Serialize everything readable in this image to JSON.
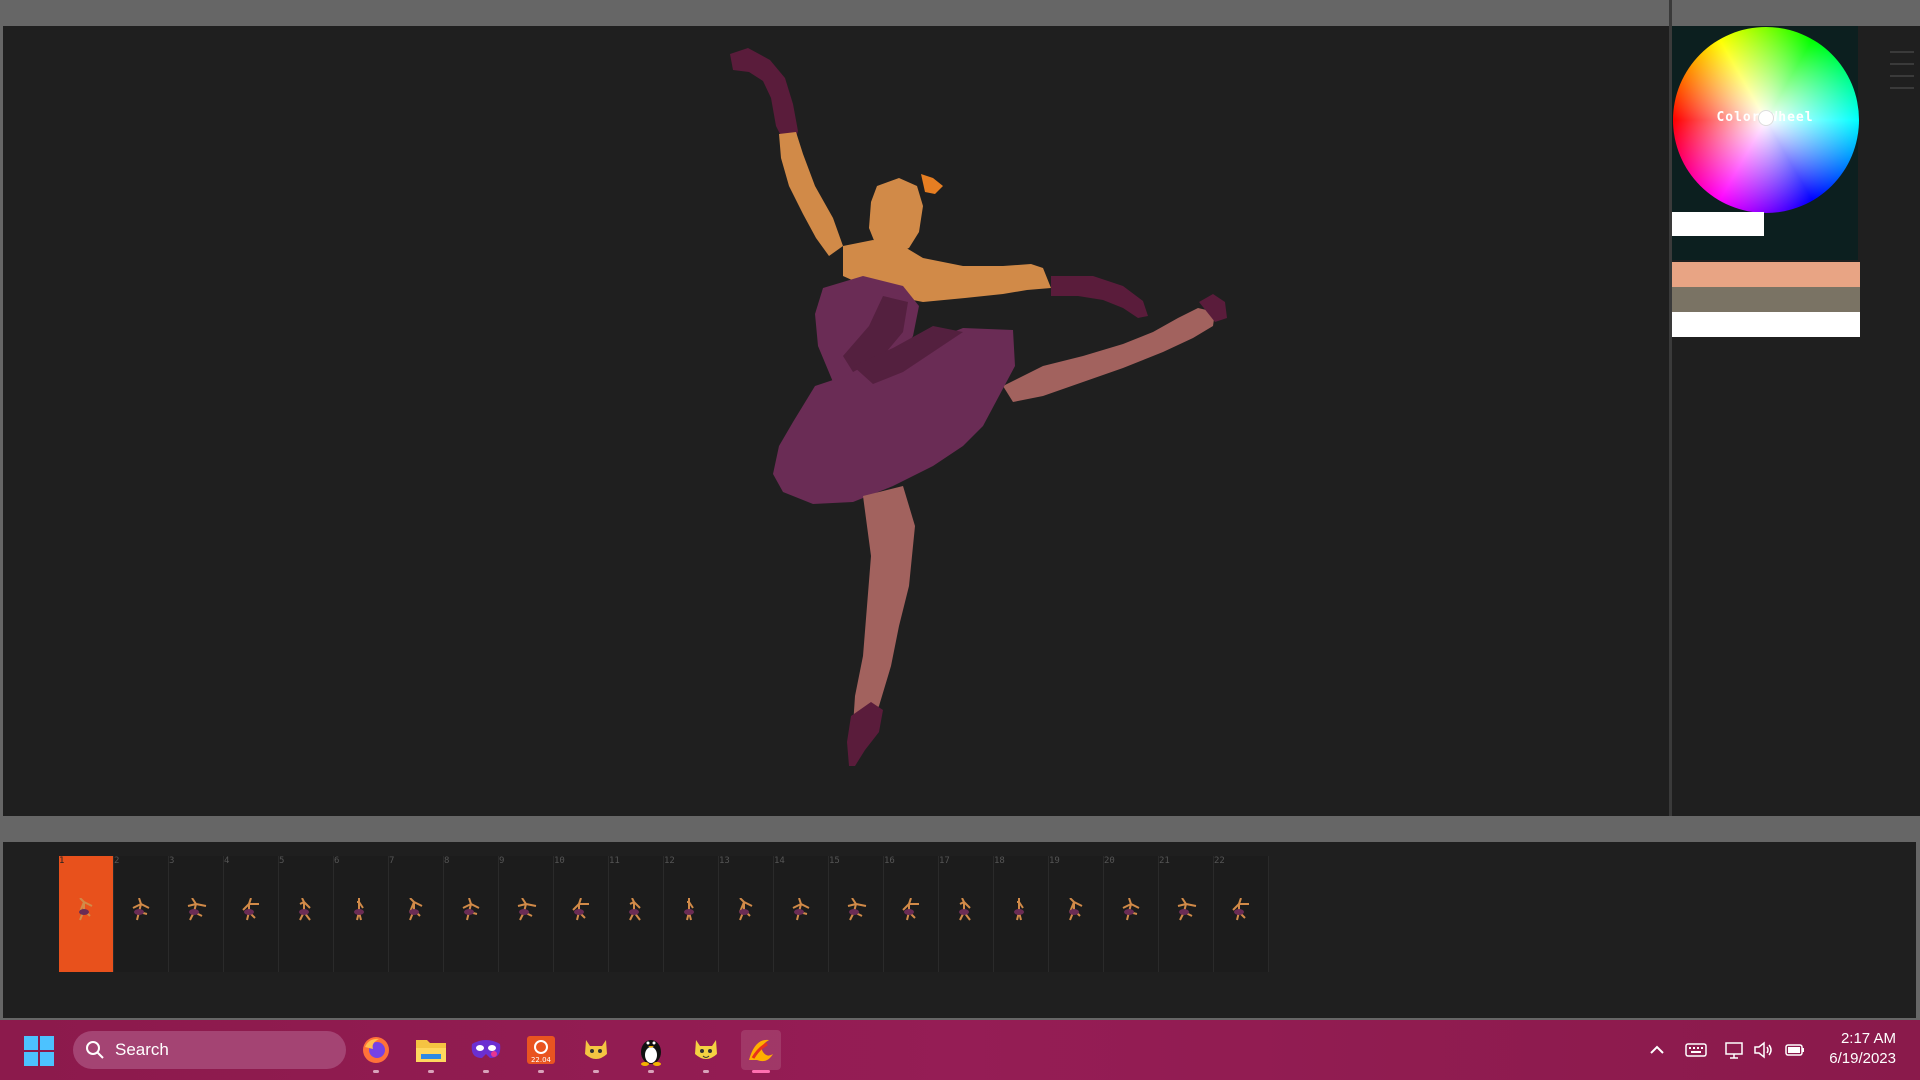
{
  "canvas": {
    "background": "#1f1f1f",
    "figure": {
      "colors": {
        "skin_light": "#d18a48",
        "skin_shadow": "#a2625e",
        "dress": "#6a2c55",
        "dress_dark": "#54203f",
        "glove": "#5a1c3b",
        "hair_accent": "#e67e22"
      }
    }
  },
  "color_panel": {
    "wheel_label": "Color Wheel",
    "hex_value": "",
    "swatches": [
      "#e8a484",
      "#7a7364",
      "#ffffff"
    ]
  },
  "timeline": {
    "frame_count": 22,
    "active_frame": 1,
    "active_color": "#e8511c",
    "frame_numbers": [
      "1",
      "2",
      "3",
      "4",
      "5",
      "6",
      "7",
      "8",
      "9",
      "10",
      "11",
      "12",
      "13",
      "14",
      "15",
      "16",
      "17",
      "18",
      "19",
      "20",
      "21",
      "22"
    ]
  },
  "taskbar": {
    "search_placeholder": "Search",
    "apps": [
      {
        "name": "firefox-icon",
        "active": false
      },
      {
        "name": "file-explorer-icon",
        "active": false
      },
      {
        "name": "mask-app-icon",
        "active": false
      },
      {
        "name": "ubuntu-2204-icon",
        "badge": "22.04",
        "active": false
      },
      {
        "name": "cat-app-icon",
        "active": false
      },
      {
        "name": "linux-penguin-icon",
        "active": false
      },
      {
        "name": "cat-app-2-icon",
        "active": false
      },
      {
        "name": "drawing-app-icon",
        "active": true
      }
    ],
    "time": "2:17 AM",
    "date": "6/19/2023"
  }
}
